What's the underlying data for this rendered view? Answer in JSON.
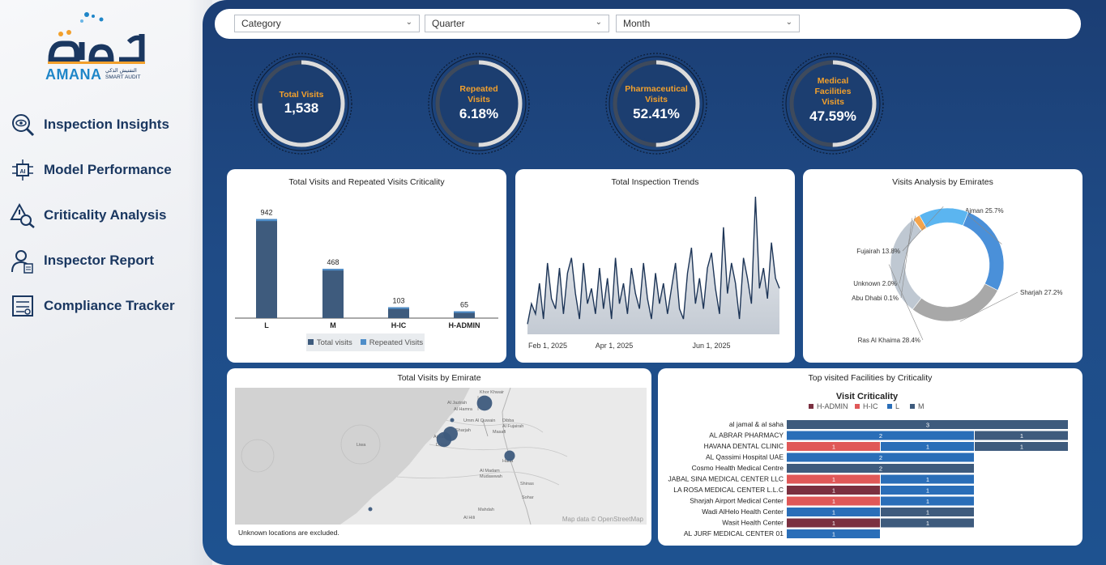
{
  "brand": {
    "name_ar": "أمانة",
    "name_en": "AMANA",
    "tagline_ar": "التفتيش الذكي",
    "tagline_en": "SMART AUDIT"
  },
  "nav": [
    {
      "label": "Inspection Insights",
      "icon": "eye-magnifier-icon"
    },
    {
      "label": "Model Performance",
      "icon": "ai-chip-icon"
    },
    {
      "label": "Criticality Analysis",
      "icon": "warning-magnifier-icon"
    },
    {
      "label": "Inspector Report",
      "icon": "inspector-icon"
    },
    {
      "label": "Compliance Tracker",
      "icon": "tracker-icon"
    }
  ],
  "filters": [
    {
      "label": "Category"
    },
    {
      "label": "Quarter"
    },
    {
      "label": "Month"
    }
  ],
  "kpis": [
    {
      "label_lines": [
        "Total Visits"
      ],
      "value": "1,538",
      "fraction": 0.75
    },
    {
      "label_lines": [
        "Repeated",
        "Visits"
      ],
      "value": "6.18%",
      "fraction": 0.5
    },
    {
      "label_lines": [
        "Pharmaceutical",
        "Visits"
      ],
      "value": "52.41%",
      "fraction": 0.5
    },
    {
      "label_lines": [
        "Medical",
        "Facilities",
        "Visits"
      ],
      "value": "47.59%",
      "fraction": 0.5
    }
  ],
  "colors": {
    "kpi_ring_fill": "#dcdcdc",
    "kpi_ring_track": "#3e4a5c",
    "kpi_label": "#f2a02c",
    "bar_total": "#3e5b7d",
    "bar_repeated": "#4f8ec9",
    "line_color": "#1d3557",
    "crit_hadmin": "#7b3040",
    "crit_hic": "#e05858",
    "crit_l": "#2a6eb8",
    "crit_m": "#3e5b7d"
  },
  "cards": {
    "criticality_title": "Total Visits and Repeated Visits Criticality",
    "trends_title": "Total Inspection Trends",
    "emirates_title": "Visits Analysis by Emirates",
    "map_title": "Total Visits by Emirate",
    "facilities_title": "Top visited Facilities by Criticality",
    "map_note": "Unknown locations are excluded.",
    "map_attribution": "Map data © OpenStreetMap",
    "legend_total": "Total visits",
    "legend_repeated": "Repeated Visits"
  },
  "chart_data": [
    {
      "type": "bar",
      "title": "Total Visits and Repeated Visits Criticality",
      "categories": [
        "L",
        "M",
        "H-IC",
        "H-ADMIN"
      ],
      "series": [
        {
          "name": "Total visits",
          "values": [
            942,
            468,
            103,
            65
          ]
        },
        {
          "name": "Repeated Visits",
          "values": [
            20,
            10,
            3,
            2
          ]
        }
      ],
      "ylim": [
        0,
        1000
      ]
    },
    {
      "type": "area",
      "title": "Total Inspection Trends",
      "x_ticks": [
        "Feb 1, 2025",
        "Apr 1, 2025",
        "Jun 1, 2025"
      ],
      "values": [
        2,
        6,
        4,
        10,
        3,
        14,
        7,
        5,
        13,
        4,
        12,
        15,
        8,
        3,
        14,
        6,
        9,
        4,
        13,
        5,
        11,
        3,
        15,
        6,
        10,
        4,
        13,
        8,
        5,
        14,
        7,
        3,
        12,
        6,
        10,
        4,
        9,
        14,
        5,
        3,
        12,
        17,
        6,
        11,
        5,
        13,
        16,
        9,
        4,
        21,
        8,
        14,
        10,
        3,
        15,
        11,
        6,
        27,
        9,
        13,
        7,
        18,
        11,
        9
      ],
      "grid": false
    },
    {
      "type": "pie",
      "title": "Visits Analysis by Emirates",
      "labels": [
        "Ajman",
        "Sharjah",
        "Ras Al Khaima",
        "Abu Dhabi",
        "Unknown",
        "Fujairah"
      ],
      "values": [
        25.7,
        27.2,
        28.4,
        0.1,
        2.0,
        13.8
      ],
      "display": [
        "Ajman 25.7%",
        "Sharjah 27.2%",
        "Ras Al Khaima 28.4%",
        "Abu Dhabi 0.1%",
        "Unknown 2.0%",
        "Fujairah 13.8%"
      ],
      "colors": [
        "#4a90d9",
        "#a8a8a8",
        "#bfc8d2",
        "#e05858",
        "#f5a44a",
        "#5bb5f0"
      ]
    },
    {
      "type": "bar",
      "orientation": "horizontal",
      "stacked": true,
      "title": "Top visited Facilities by Criticality",
      "legend_title": "Visit Criticality",
      "legend": [
        "H-ADMIN",
        "H-IC",
        "L",
        "M"
      ],
      "categories": [
        "al jamal & al saha",
        "AL ABRAR PHARMACY",
        "HAVANA DENTAL CLINIC",
        "AL Qassimi Hospital UAE",
        "Cosmo Health Medical Centre",
        "JABAL SINA MEDICAL CENTER  LLC",
        "LA ROSA MEDICAL CENTER L.L.C",
        "Sharjah Airport Medical Center",
        "Wadi AlHelo Health Center",
        "Wasit Health Center",
        "AL JURF MEDICAL CENTER 01"
      ],
      "series": [
        {
          "name": "H-ADMIN",
          "values": [
            0,
            0,
            0,
            0,
            0,
            0,
            1,
            0,
            0,
            1,
            0
          ]
        },
        {
          "name": "H-IC",
          "values": [
            0,
            0,
            1,
            0,
            0,
            1,
            0,
            1,
            0,
            0,
            0
          ]
        },
        {
          "name": "L",
          "values": [
            0,
            2,
            1,
            2,
            0,
            1,
            1,
            1,
            1,
            0,
            1
          ]
        },
        {
          "name": "M",
          "values": [
            3,
            1,
            1,
            0,
            2,
            0,
            0,
            0,
            1,
            1,
            0
          ]
        }
      ]
    }
  ],
  "map": {
    "places": [
      "Khor Khwair",
      "Al Jazirah",
      "Al Hamra",
      "Al Fujairah",
      "Dibba",
      "Masafi",
      "Ajman",
      "Umm Al Quwain",
      "Sharjah",
      "Dubai",
      "Al Madam",
      "Mudawwah",
      "Shinas",
      "Sohar",
      "Hatta",
      "Mahdah",
      "Al Hili",
      "Liwa"
    ],
    "bubbles": [
      {
        "place": "Ras Al Khaimah",
        "value": 436
      },
      {
        "place": "Umm Al Quwain",
        "value": 20
      },
      {
        "place": "Ajman",
        "value": 395
      },
      {
        "place": "Sharjah",
        "value": 418
      },
      {
        "place": "Fujairah",
        "value": 212
      },
      {
        "place": "Abu Dhabi",
        "value": 2
      }
    ]
  }
}
